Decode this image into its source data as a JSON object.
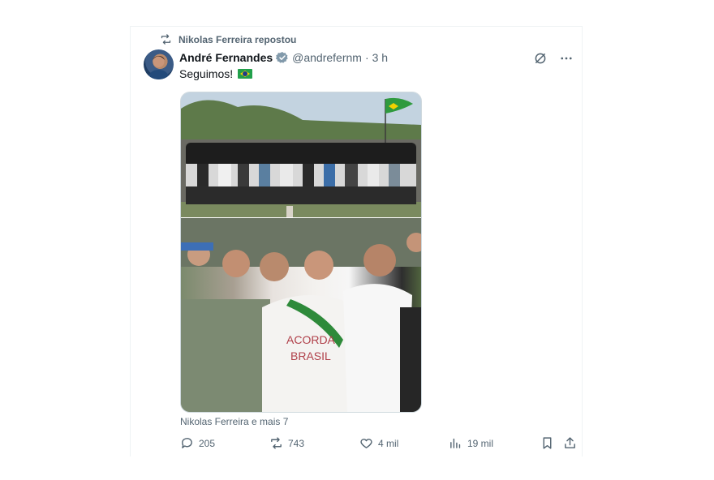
{
  "repost_label": "Nikolas Ferreira repostou",
  "author": {
    "name": "André Fernandes",
    "handle": "@andrefernm",
    "separator": "·",
    "time": "3 h"
  },
  "text": "Seguimos!",
  "flag_icon": "brazil-flag-emoji",
  "media_tags": "Nikolas Ferreira e mais 7",
  "actions": {
    "replies": "205",
    "reposts": "743",
    "likes": "4 mil",
    "views": "19 mil"
  },
  "colors": {
    "verified": "#829aab",
    "muted": "#536471"
  }
}
